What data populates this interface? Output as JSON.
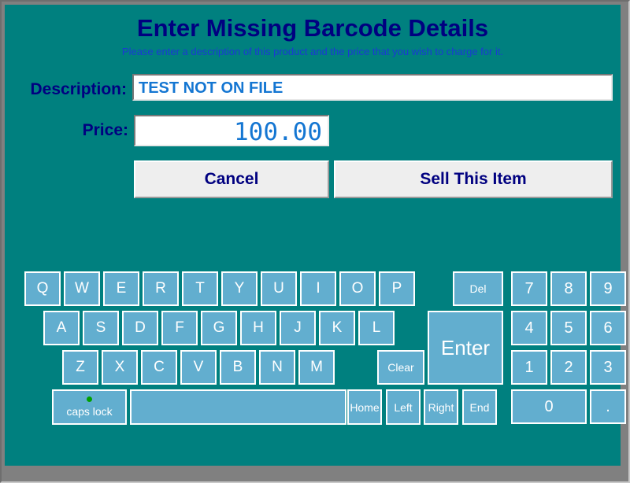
{
  "window": {
    "title": "Enter Missing Barcode Details",
    "subtitle": "Please enter a description of this product and the price that you wish to charge for it.",
    "background_color": "#00807f",
    "title_color": "#000080",
    "subtitle_color": "#1b39d4"
  },
  "form": {
    "description": {
      "label": "Description:",
      "value": "TEST NOT ON FILE",
      "placeholder": ""
    },
    "price": {
      "label": "Price:",
      "value": "100.00",
      "placeholder": ""
    }
  },
  "actions": {
    "cancel_label": "Cancel",
    "sell_label": "Sell This Item"
  },
  "keyboard": {
    "key_color": "#62aecf",
    "key_text_color": "#ffffff",
    "caps_lock_label": "caps lock",
    "caps_lock_led_color": "#00a000",
    "row1": [
      "Q",
      "W",
      "E",
      "R",
      "T",
      "Y",
      "U",
      "I",
      "O",
      "P"
    ],
    "row2": [
      "A",
      "S",
      "D",
      "F",
      "G",
      "H",
      "J",
      "K",
      "L"
    ],
    "row3": [
      "Z",
      "X",
      "C",
      "V",
      "B",
      "N",
      "M"
    ],
    "space_label": "",
    "edit_keys": [
      "Del",
      "Clear"
    ],
    "nav_keys": [
      "Home",
      "Left",
      "Right",
      "End"
    ],
    "enter_label": "Enter",
    "numpad": [
      "7",
      "8",
      "9",
      "4",
      "5",
      "6",
      "1",
      "2",
      "3",
      "0",
      "."
    ]
  }
}
